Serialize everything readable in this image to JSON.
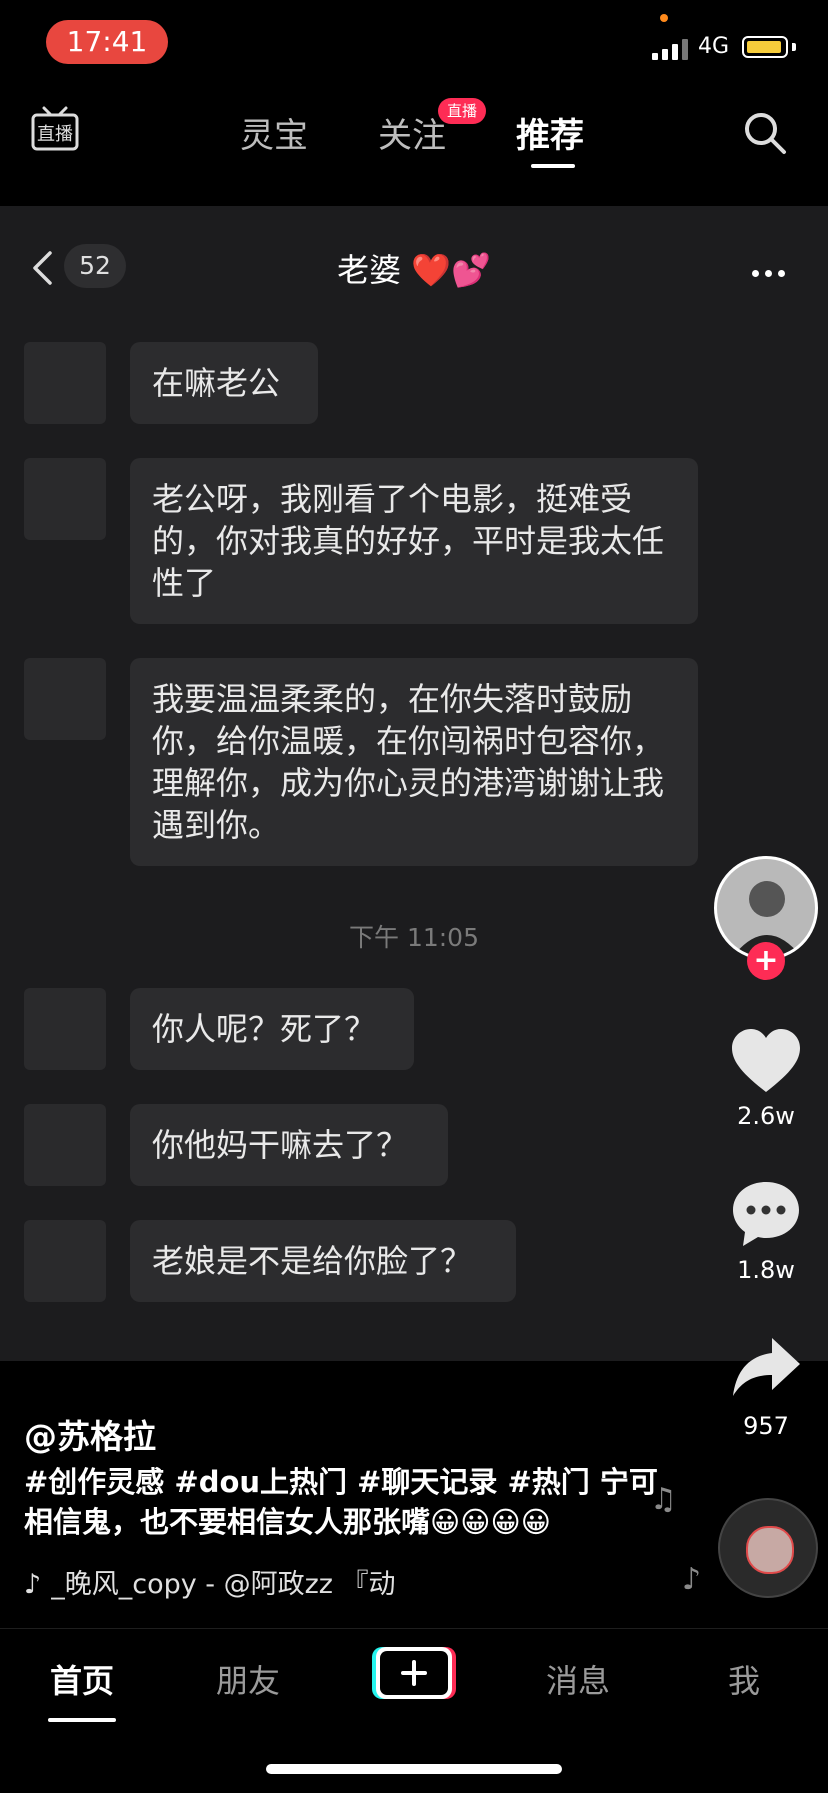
{
  "status_bar": {
    "time": "17:41",
    "network": "4G"
  },
  "top_nav": {
    "tabs": [
      {
        "label": "灵宝"
      },
      {
        "label": "关注"
      },
      {
        "label": "推荐"
      }
    ],
    "live_badge": "直播"
  },
  "chat": {
    "unread_count": "52",
    "title": "老婆 ❤️💕",
    "messages": [
      {
        "text": "在嘛老公"
      },
      {
        "text": "老公呀，我刚看了个电影，挺难受的，你对我真的好好，平时是我太任性了"
      },
      {
        "text": "我要温温柔柔的，在你失落时鼓励你，给你温暖，在你闯祸时包容你，理解你，成为你心灵的港湾谢谢让我遇到你。"
      },
      {
        "text": "你人呢？死了？"
      },
      {
        "text": "你他妈干嘛去了？"
      },
      {
        "text": "老娘是不是给你脸了？"
      }
    ],
    "timestamp": "下午 11:05"
  },
  "right_rail": {
    "likes": "2.6w",
    "comments": "1.8w",
    "shares": "957"
  },
  "caption": {
    "author": "@苏格拉",
    "text": "#创作灵感 #dou上热门 #聊天记录 #热门 宁可相信鬼，也不要相信女人那张嘴😀😀😀😀",
    "music": "_晚风_copy - @阿政zz 『动"
  },
  "bottom_nav": {
    "tabs": [
      {
        "label": "首页"
      },
      {
        "label": "朋友"
      },
      {
        "label": "消息"
      },
      {
        "label": "我"
      }
    ]
  },
  "colors": {
    "accent": "#fe2c55",
    "time_pill": "#e8473f",
    "bubble": "#2c2c2e"
  }
}
